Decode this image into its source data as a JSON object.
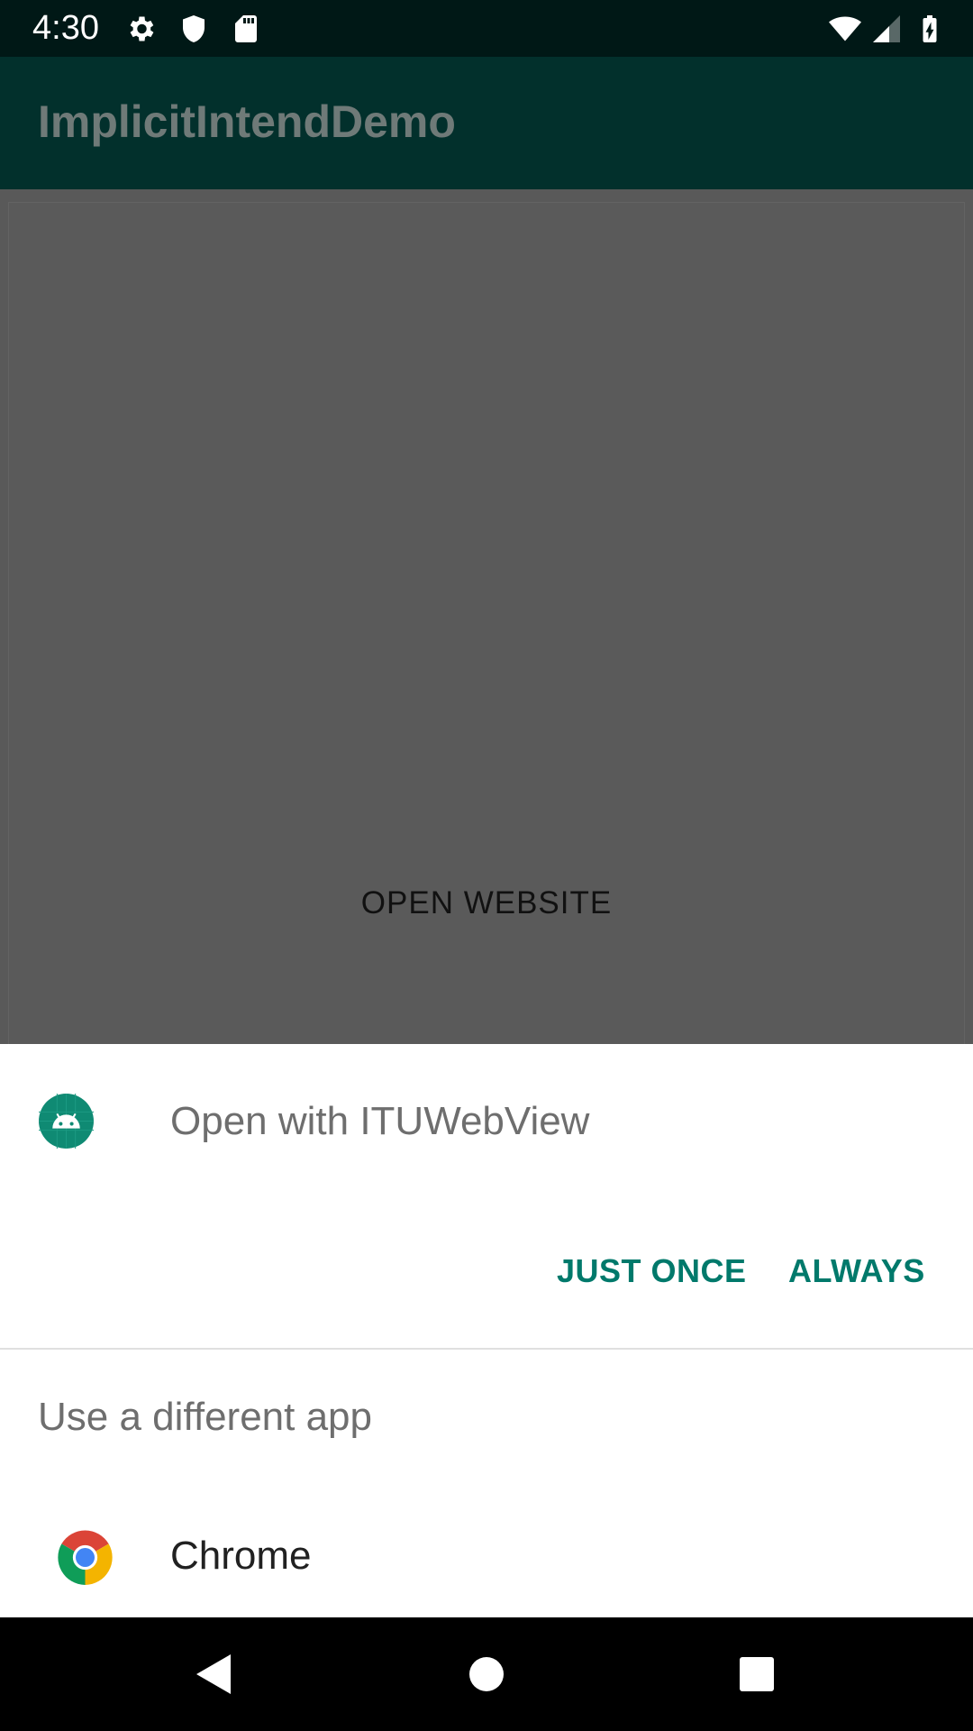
{
  "status_bar": {
    "time": "4:30",
    "icons_left": [
      "settings-icon",
      "shield-icon",
      "sd-card-icon"
    ],
    "icons_right": [
      "wifi-icon",
      "cell-signal-icon",
      "battery-charging-icon"
    ]
  },
  "app_bar": {
    "title": "ImplicitIntendDemo"
  },
  "content": {
    "button_label": "OPEN WEBSITE"
  },
  "sheet": {
    "title": "Open with ITUWebView",
    "just_once_label": "JUST ONCE",
    "always_label": "ALWAYS",
    "different_app_label": "Use a different app",
    "apps": [
      {
        "label": "Chrome",
        "icon": "chrome-icon"
      }
    ]
  },
  "nav_bar": {
    "icons": [
      "back-icon",
      "home-icon",
      "recents-icon"
    ]
  },
  "colors": {
    "accent": "#00796b",
    "app_bar": "#02302c",
    "status_bar": "#001816"
  }
}
